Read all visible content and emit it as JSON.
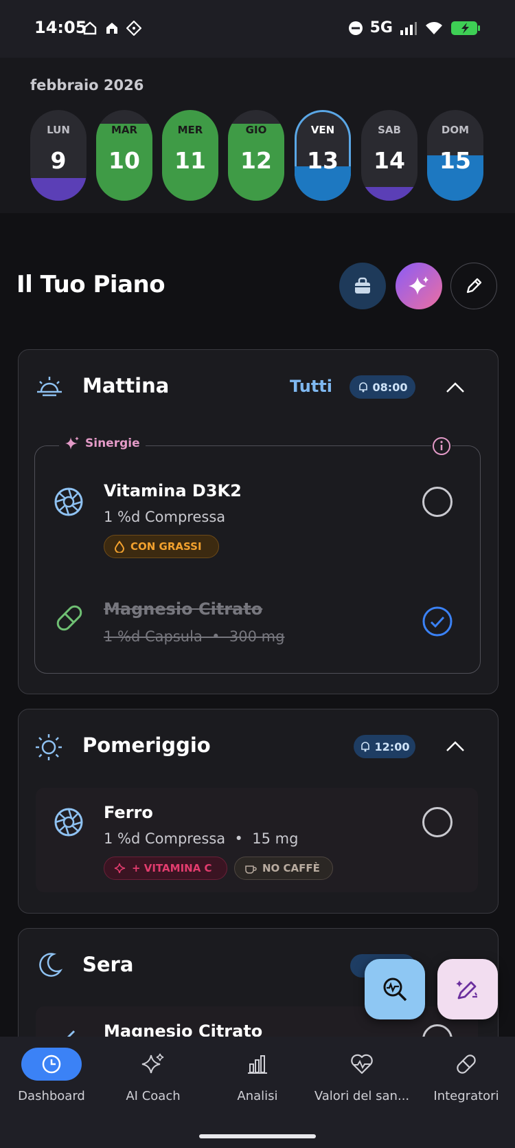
{
  "status_bar": {
    "time": "14:05",
    "network": "5G"
  },
  "calendar": {
    "month": "febbraio 2026",
    "days": [
      {
        "name": "LUN",
        "num": "9",
        "fill": 0.25,
        "color": "#5b3fb6"
      },
      {
        "name": "MAR",
        "num": "10",
        "fill": 0.85,
        "color": "#3f9b46"
      },
      {
        "name": "MER",
        "num": "11",
        "fill": 1.0,
        "color": "#3f9b46"
      },
      {
        "name": "GIO",
        "num": "12",
        "fill": 0.85,
        "color": "#3f9b46"
      },
      {
        "name": "VEN",
        "num": "13",
        "fill": 0.38,
        "color": "#1d78c1",
        "selected": true
      },
      {
        "name": "SAB",
        "num": "14",
        "fill": 0.15,
        "color": "#5b3fb6"
      },
      {
        "name": "DOM",
        "num": "15",
        "fill": 0.5,
        "color": "#1d78c1"
      }
    ]
  },
  "plan": {
    "title": "Il Tuo Piano",
    "buttons": [
      "bag-icon",
      "sparkle-icon",
      "pencil-icon"
    ]
  },
  "sections": {
    "morning": {
      "title": "Mattina",
      "all_label": "Tutti",
      "alarm": "08:00",
      "synergy_label": "Sinergie",
      "items": [
        {
          "name": "Vitamina D3K2",
          "dose": "1 %d Compressa",
          "tag": "CON GRASSI",
          "done": false
        },
        {
          "name": "Magnesio Citrato",
          "dose": "1 %d Capsula  •  300 mg",
          "done": true
        }
      ]
    },
    "afternoon": {
      "title": "Pomeriggio",
      "alarm": "12:00",
      "items": [
        {
          "name": "Ferro",
          "dose": "1 %d Compressa  •  15 mg",
          "tags": [
            "+ VITAMINA C",
            "NO CAFFÈ"
          ],
          "done": false
        }
      ]
    },
    "evening": {
      "title": "Sera",
      "items": [
        {
          "name": "Magnesio Citrato"
        }
      ]
    }
  },
  "nav": [
    {
      "label": "Dashboard",
      "icon": "clock-icon",
      "active": true
    },
    {
      "label": "AI Coach",
      "icon": "sparkle-icon"
    },
    {
      "label": "Analisi",
      "icon": "bar-chart-icon"
    },
    {
      "label": "Valori del san...",
      "icon": "heart-pulse-icon"
    },
    {
      "label": "Integratori",
      "icon": "pill-icon"
    }
  ],
  "colors": {
    "accent": "#3b82f6",
    "synergy": "#e39ac7",
    "tag_fat": "#f2a12e",
    "tag_vitc": "#e23c6e"
  }
}
